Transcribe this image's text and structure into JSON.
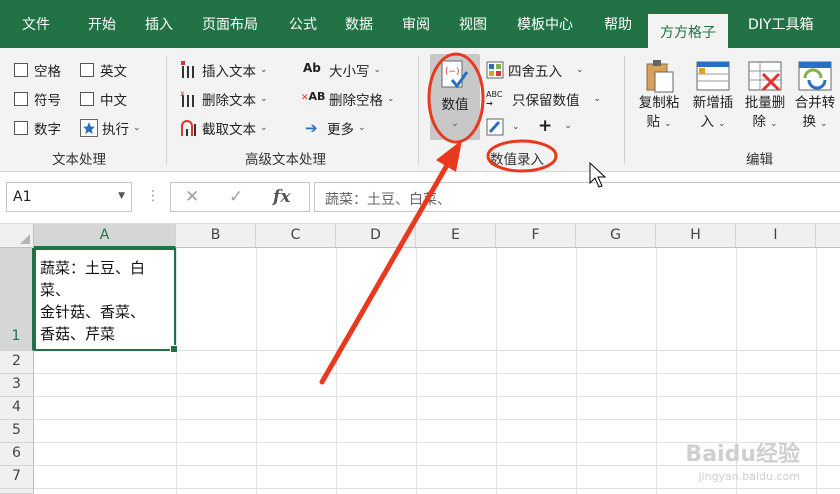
{
  "tabs": [
    "文件",
    "开始",
    "插入",
    "页面布局",
    "公式",
    "数据",
    "审阅",
    "视图",
    "模板中心",
    "帮助",
    "方方格子",
    "DIY工具箱"
  ],
  "active_tab": "方方格子",
  "ribbon": {
    "text_group": {
      "checkboxes": [
        "空格",
        "英文",
        "符号",
        "中文",
        "数字"
      ],
      "execute": "执行",
      "label": "文本处理"
    },
    "advanced_group": {
      "insert_text": "插入文本",
      "delete_text": "删除文本",
      "extract_text": "截取文本",
      "case": "大小写",
      "delete_space": "删除空格",
      "more": "更多",
      "label": "高级文本处理"
    },
    "numeric_group": {
      "numeric_btn": "数值",
      "round": "四舍五入",
      "keep_numeric": "只保留数值",
      "plus": "+",
      "label": "数值录入"
    },
    "edit_group": {
      "copy_paste_1": "复制粘",
      "copy_paste_2": "贴",
      "new_insert_1": "新增插",
      "new_insert_2": "入",
      "batch_delete_1": "批量删",
      "batch_delete_2": "除",
      "merge_1": "合并转",
      "merge_2": "换",
      "label": "编辑"
    }
  },
  "formula_bar": {
    "name_box": "A1",
    "cancel": "✕",
    "confirm": "✓",
    "fx": "fx",
    "content": "蔬菜：土豆、白菜、"
  },
  "columns": [
    "A",
    "B",
    "C",
    "D",
    "E",
    "F",
    "G",
    "H",
    "I"
  ],
  "rows": [
    "1",
    "2",
    "3",
    "4",
    "5",
    "6",
    "7"
  ],
  "cell_a1": "蔬菜：土豆、白\n菜、\n金针菇、香菜、\n香菇、芹菜",
  "watermark": "Baidu经验",
  "watermark_sub": "jingyan.baidu.com",
  "colors": {
    "brand": "#217346",
    "annotation": "#e8391f"
  }
}
